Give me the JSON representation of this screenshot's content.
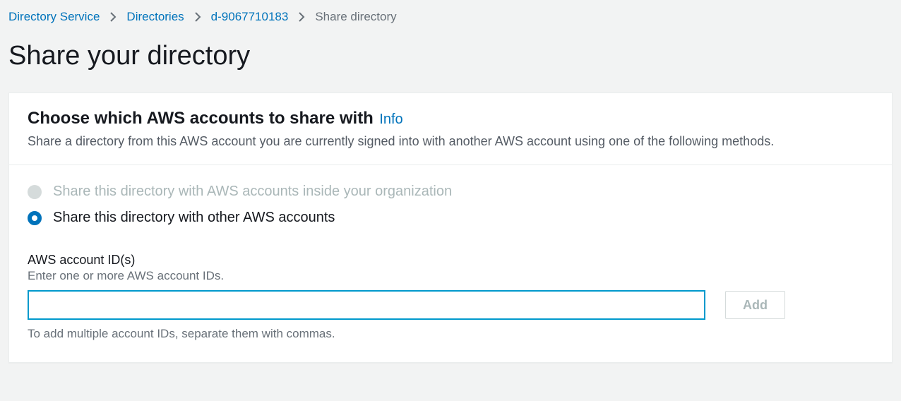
{
  "breadcrumb": {
    "items": [
      {
        "label": "Directory Service",
        "link": true
      },
      {
        "label": "Directories",
        "link": true
      },
      {
        "label": "d-9067710183",
        "link": true
      },
      {
        "label": "Share directory",
        "link": false
      }
    ]
  },
  "page": {
    "title": "Share your directory"
  },
  "panel": {
    "heading": "Choose which AWS accounts to share with",
    "info": "Info",
    "subtitle": "Share a directory from this AWS account you are currently signed into with another AWS account using one of the following methods."
  },
  "radios": {
    "option_org": "Share this directory with AWS accounts inside your organization",
    "option_other": "Share this directory with other AWS accounts"
  },
  "field": {
    "label": "AWS account ID(s)",
    "hint": "Enter one or more AWS account IDs.",
    "value": "",
    "helper": "To add multiple account IDs, separate them with commas.",
    "add_label": "Add"
  }
}
